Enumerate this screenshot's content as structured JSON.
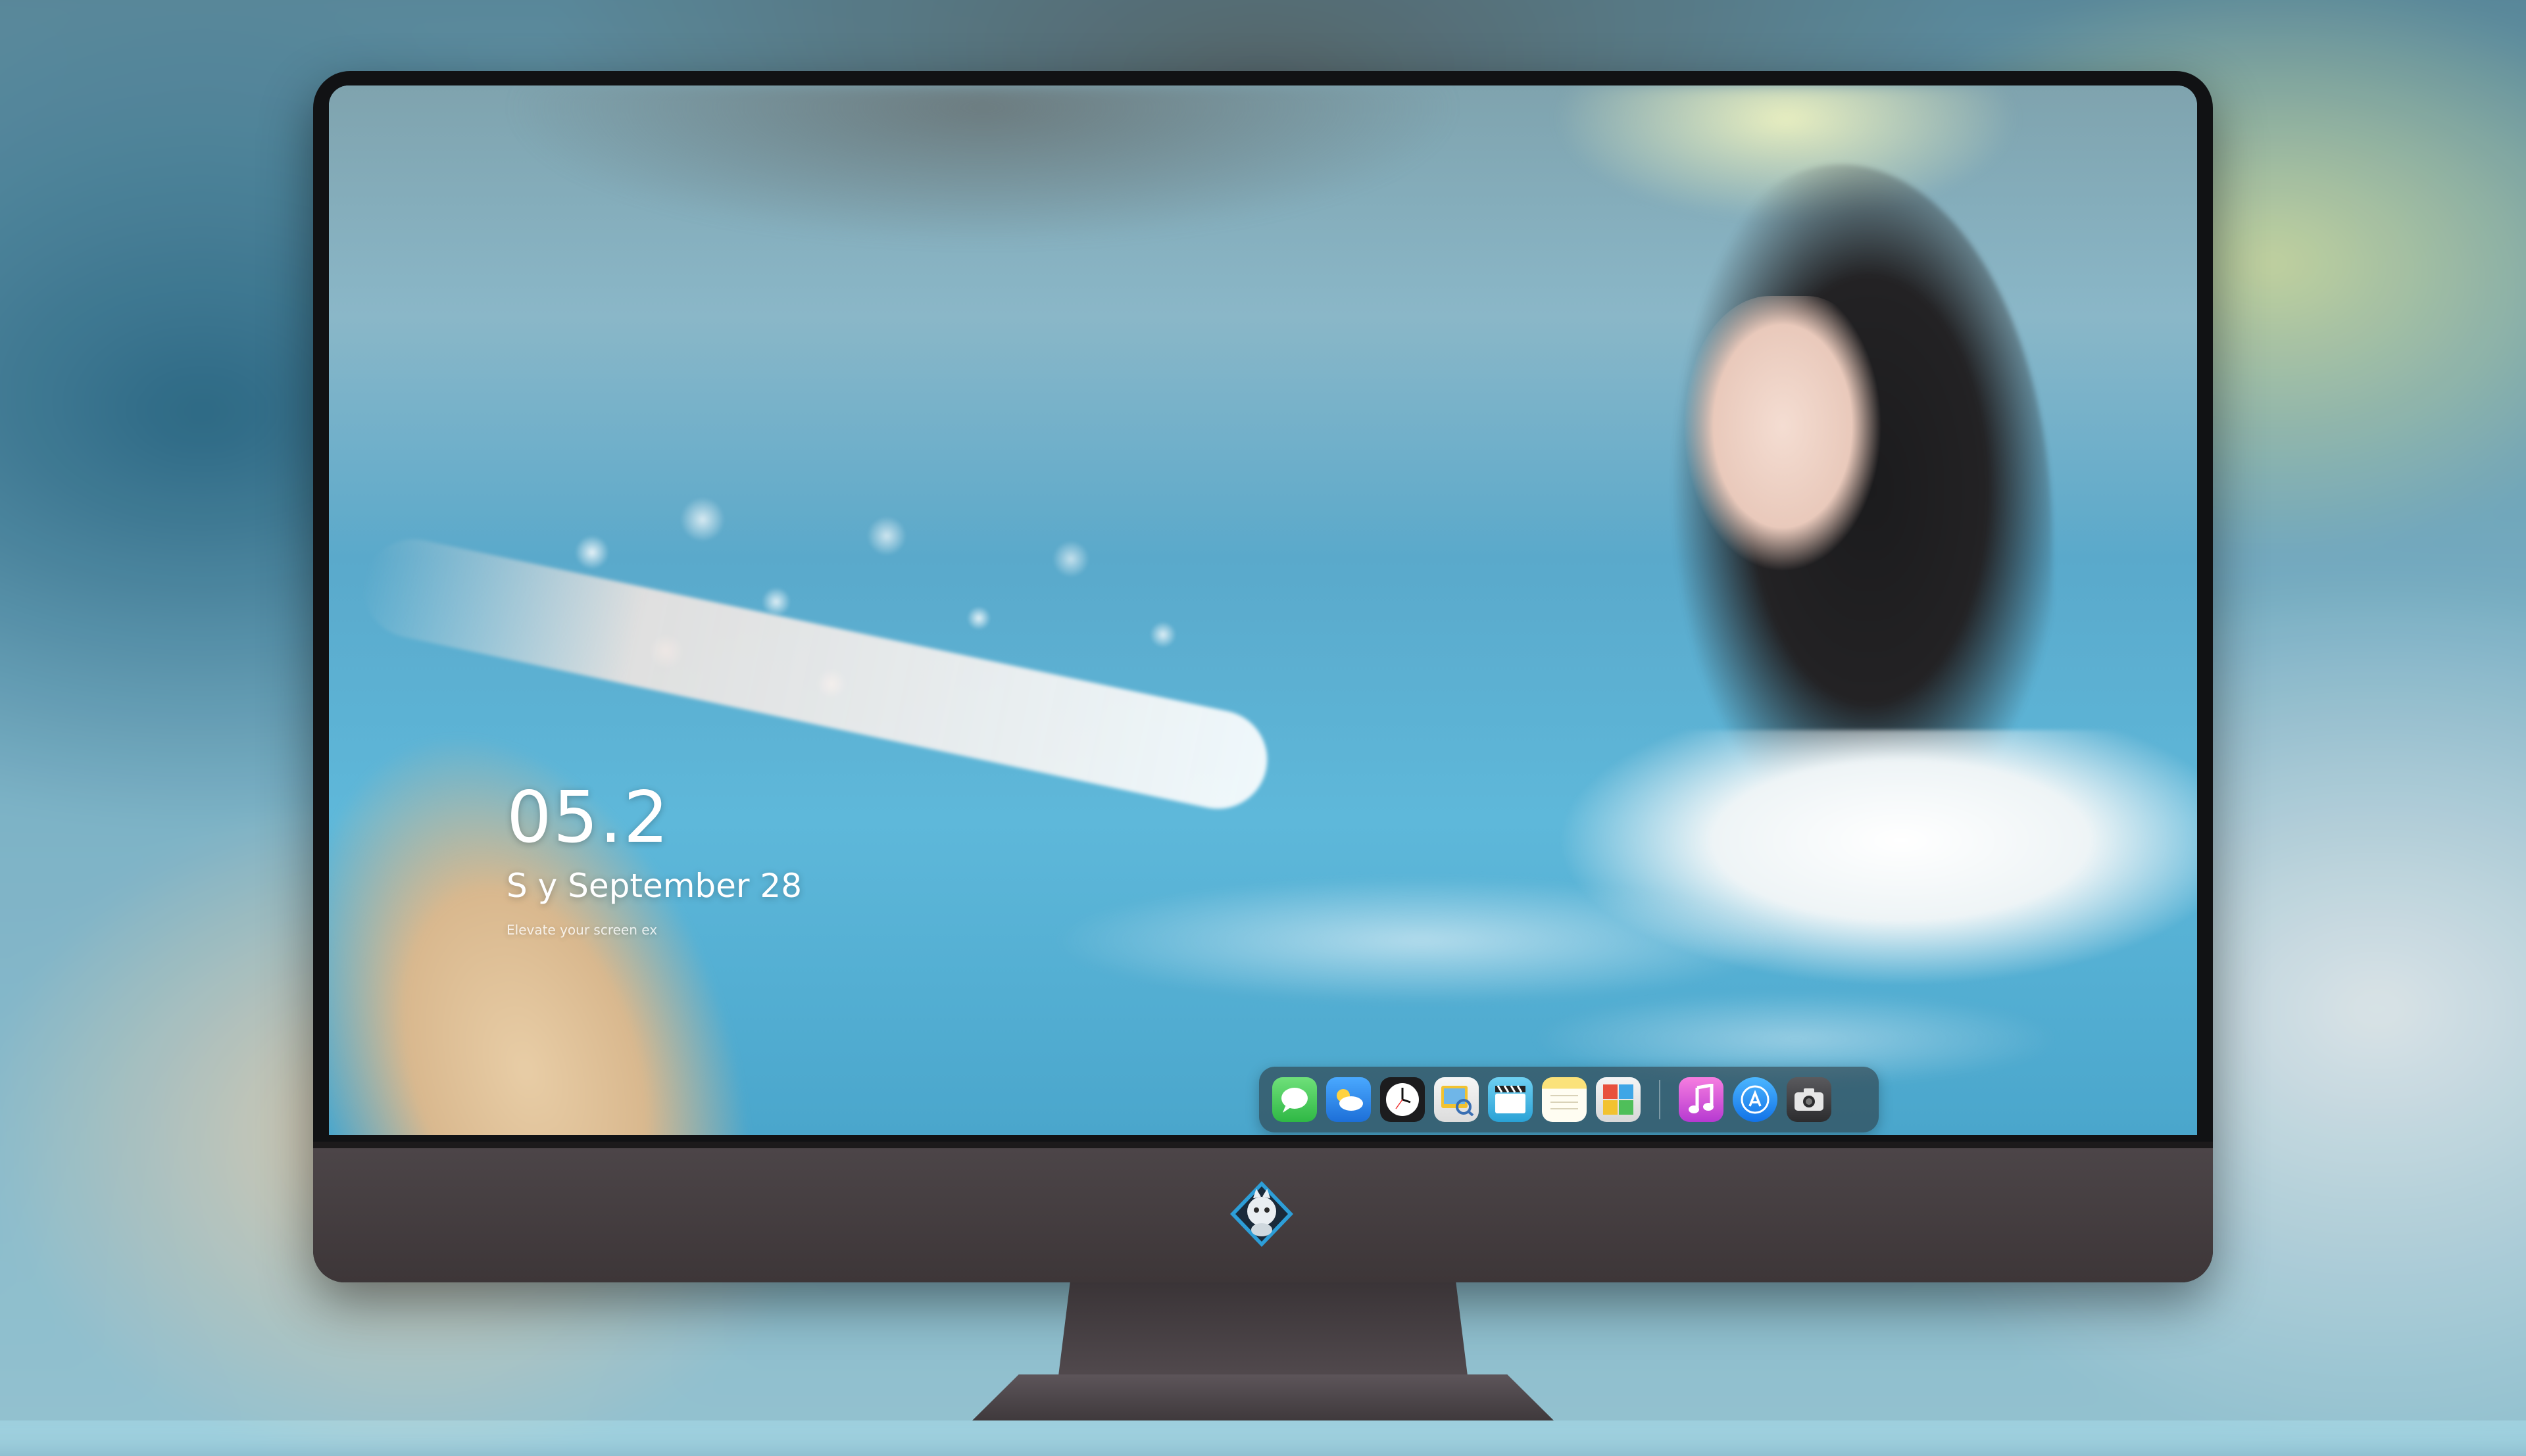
{
  "lockscreen": {
    "time": "05.2",
    "date": "S    y September 28",
    "tagline": "Elevate your screen ex"
  },
  "dock": {
    "apps": [
      {
        "name": "Messages",
        "icon": "messages-icon",
        "color": "#34c759"
      },
      {
        "name": "Weather",
        "icon": "weather-icon",
        "color": "#2f8df5"
      },
      {
        "name": "Clock",
        "icon": "clock-icon",
        "color": "#1c1c1e"
      },
      {
        "name": "Preview",
        "icon": "preview-icon",
        "color": "#e9c23a"
      },
      {
        "name": "Final Cut Pro",
        "icon": "clapperboard-icon",
        "color": "#3ab6e3"
      },
      {
        "name": "Notes",
        "icon": "notes-icon",
        "color": "#f7d54a"
      },
      {
        "name": "Photo Booth",
        "icon": "photo-booth-icon",
        "color": "#d9534f"
      },
      {
        "name": "iTunes",
        "icon": "music-icon",
        "color": "#d94fd1"
      },
      {
        "name": "App Store",
        "icon": "app-store-icon",
        "color": "#1e8ff4"
      },
      {
        "name": "Screenshot",
        "icon": "camera-icon",
        "color": "#3a3a3c"
      }
    ]
  },
  "monitor": {
    "logo": "mascot-logo-icon",
    "bezel_color": "#111214",
    "chin_color": "#473f43"
  }
}
